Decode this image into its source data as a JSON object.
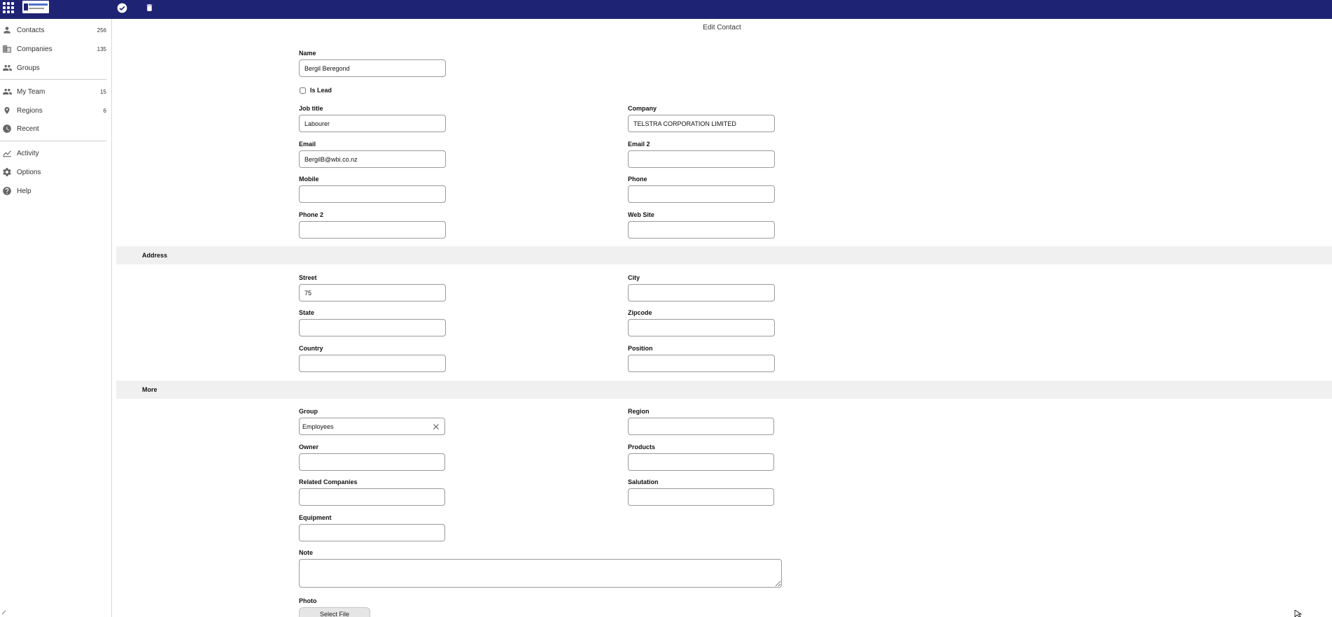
{
  "toolbar": {
    "apps_icon": "apps-grid-icon",
    "logo_icon": "brand-logo",
    "save_icon": "check-circle-icon",
    "delete_icon": "trash-icon"
  },
  "sidebar": {
    "items": [
      {
        "label": "Contacts",
        "count": "256",
        "icon": "person-icon"
      },
      {
        "label": "Companies",
        "count": "135",
        "icon": "building-icon"
      },
      {
        "label": "Groups",
        "count": "",
        "icon": "people-icon"
      },
      {
        "label": "My Team",
        "count": "15",
        "icon": "team-icon"
      },
      {
        "label": "Regions",
        "count": "6",
        "icon": "location-pin-icon"
      },
      {
        "label": "Recent",
        "count": "",
        "icon": "clock-icon"
      },
      {
        "label": "Activity",
        "count": "",
        "icon": "chart-icon"
      },
      {
        "label": "Options",
        "count": "",
        "icon": "gear-icon"
      },
      {
        "label": "Help",
        "count": "",
        "icon": "help-icon"
      }
    ]
  },
  "form": {
    "title": "Edit Contact",
    "name": {
      "label": "Name",
      "value": "Bergil Beregond"
    },
    "is_lead": {
      "label": "Is Lead",
      "checked": false
    },
    "job_title": {
      "label": "Job title",
      "value": "Labourer"
    },
    "company": {
      "label": "Company",
      "value": "TELSTRA CORPORATION LIMITED"
    },
    "email": {
      "label": "Email",
      "value": "BergilB@wbi.co.nz"
    },
    "email2": {
      "label": "Email 2",
      "value": ""
    },
    "mobile": {
      "label": "Mobile",
      "value": ""
    },
    "phone": {
      "label": "Phone",
      "value": ""
    },
    "phone2": {
      "label": "Phone 2",
      "value": ""
    },
    "website": {
      "label": "Web Site",
      "value": ""
    },
    "address_section": "Address",
    "street": {
      "label": "Street",
      "value": "75"
    },
    "city": {
      "label": "City",
      "value": ""
    },
    "state": {
      "label": "State",
      "value": ""
    },
    "zipcode": {
      "label": "Zipcode",
      "value": ""
    },
    "country": {
      "label": "Country",
      "value": ""
    },
    "position": {
      "label": "Position",
      "value": ""
    },
    "more_section": "More",
    "group": {
      "label": "Group",
      "value": "Employees"
    },
    "region": {
      "label": "Region",
      "value": ""
    },
    "owner": {
      "label": "Owner",
      "value": ""
    },
    "products": {
      "label": "Products",
      "value": ""
    },
    "related_companies": {
      "label": "Related Companies",
      "value": ""
    },
    "salutation": {
      "label": "Salutation",
      "value": ""
    },
    "equipment": {
      "label": "Equipment",
      "value": ""
    },
    "note": {
      "label": "Note",
      "value": ""
    },
    "photo": {
      "label": "Photo",
      "button": "Select File"
    }
  },
  "colors": {
    "topbar": "#1f2373",
    "section_bg": "#f0f0f0",
    "icon_gray": "#666666"
  }
}
